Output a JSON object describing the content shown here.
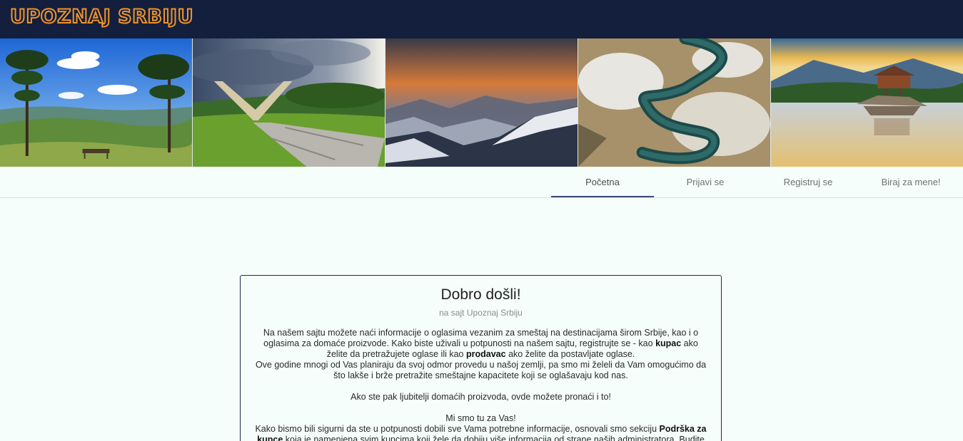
{
  "brand": {
    "logo_text": "UPOZNAJ SRBIJU"
  },
  "banner": {
    "images": [
      {
        "name": "zlatibor-pines-image"
      },
      {
        "name": "kadinjaca-monument-image"
      },
      {
        "name": "mountains-sunset-image"
      },
      {
        "name": "uvac-meanders-image"
      },
      {
        "name": "drina-river-house-image"
      }
    ]
  },
  "nav": {
    "tabs": [
      {
        "label": "Početna",
        "active": true
      },
      {
        "label": "Prijavi se",
        "active": false
      },
      {
        "label": "Registruj se",
        "active": false
      },
      {
        "label": "Biraj za mene!",
        "active": false
      }
    ]
  },
  "welcome": {
    "title": "Dobro došli!",
    "subtitle": "na sajt Upoznaj Srbiju",
    "p1_a": "Na našem sajtu možete naći informacije o oglasima vezanim za smeštaj na destinacijama širom Srbije, kao i o oglasima za domaće proizvode. Kako biste uživali u potpunosti na našem sajtu, registrujte se - kao ",
    "p1_kupac": "kupac",
    "p1_b": " ako želite da pretražujete oglase ili kao ",
    "p1_prodavac": "prodavac",
    "p1_c": " ako želite da postavljate oglase.",
    "p2": "Ove godine mnogi od Vas planiraju da svoj odmor provedu u našoj zemlji, pa smo mi želeli da Vam omogućimo da što lakše i brže pretražite smeštajne kapacitete koji se oglašavaju kod nas.",
    "p3": "Ako ste pak ljubitelji domaćih proizvoda, ovde možete pronaći i to!",
    "p4": "Mi smo tu za Vas!",
    "p5_a": "Kako bismo bili sigurni da ste u potpunosti dobili sve Vama potrebne informacije, osnovali smo sekciju ",
    "p5_support": "Podrška za kupce",
    "p5_b": " koja je namenjena svim kupcima koji žele da dobiju više informacija od strane naših administratora. Budite"
  },
  "colors": {
    "topbar": "#131f3c",
    "logo": "#f0932a",
    "page_bg": "#f5fefa",
    "active_tab_underline": "#3a4a7a"
  }
}
